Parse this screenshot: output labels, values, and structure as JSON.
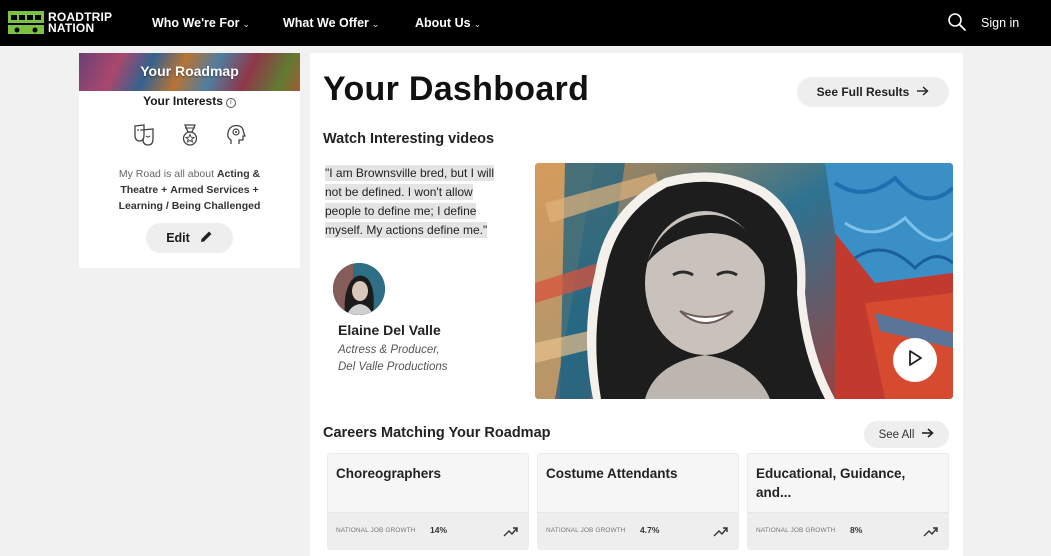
{
  "nav": {
    "logo_line1": "ROADTRIP",
    "logo_line2": "NATION",
    "items": [
      {
        "label": "Who We're For",
        "chevron": "chevron-down-icon"
      },
      {
        "label": "What We Offer",
        "chevron": "chevron-down-icon"
      },
      {
        "label": "About Us",
        "chevron": "chevron-down-icon"
      }
    ],
    "search_icon": "search-icon",
    "sign_in": "Sign in"
  },
  "roadmap": {
    "title": "Your Roadmap",
    "interests_label": "Your Interests",
    "interest_icons": [
      "theatre-masks-icon",
      "medal-icon",
      "head-gear-icon"
    ],
    "desc_prefix": "My Road is all about",
    "interest_1": "Acting & Theatre",
    "interest_2": "Armed Services",
    "interest_3": "Learning / Being Challenged",
    "separator": "+",
    "edit_label": "Edit"
  },
  "dashboard": {
    "title": "Your Dashboard",
    "full_results_label": "See Full Results"
  },
  "videos": {
    "heading": "Watch Interesting videos",
    "quote": "\"I am Brownsville bred, but I will not be defined. I won't allow people to define me; I define myself. My actions define me.\"",
    "person_name": "Elaine Del Valle",
    "person_role_1": "Actress & Producer,",
    "person_role_2": "Del Valle Productions"
  },
  "careers": {
    "heading": "Careers Matching Your Roadmap",
    "see_all_label": "See All",
    "growth_label": "NATIONAL JOB GROWTH",
    "items": [
      {
        "title": "Choreographers",
        "growth": "14%"
      },
      {
        "title": "Costume Attendants",
        "growth": "4.7%"
      },
      {
        "title": "Educational, Guidance, and...",
        "growth": "8%"
      }
    ]
  },
  "colors": {
    "nav_bg": "#000000",
    "page_bg": "#f1f1f1",
    "button_bg": "#eeeeee"
  }
}
